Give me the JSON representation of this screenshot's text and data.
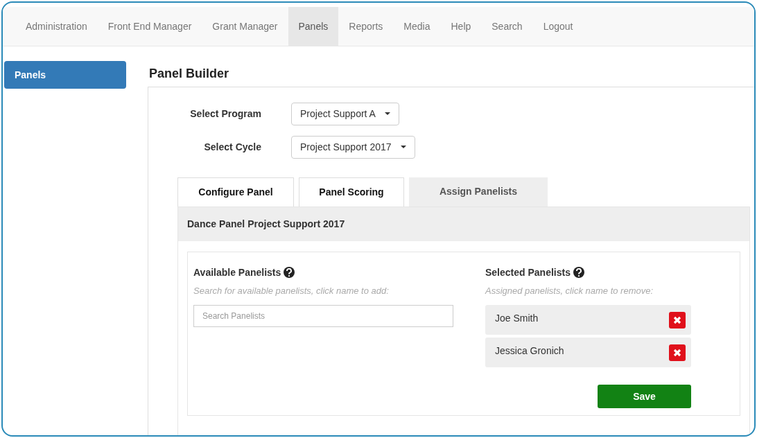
{
  "nav": [
    {
      "label": "Administration",
      "selected": false
    },
    {
      "label": "Front End Manager",
      "selected": false
    },
    {
      "label": "Grant Manager",
      "selected": false
    },
    {
      "label": "Panels",
      "selected": true
    },
    {
      "label": "Reports",
      "selected": false
    },
    {
      "label": "Media",
      "selected": false
    },
    {
      "label": "Help",
      "selected": false
    },
    {
      "label": "Search",
      "selected": false
    },
    {
      "label": "Logout",
      "selected": false
    }
  ],
  "sidebar": {
    "items": [
      {
        "label": "Panels",
        "selected": true
      }
    ]
  },
  "page_title": "Panel Builder",
  "selects": [
    {
      "label": "Select Program",
      "value": "Project Support A"
    },
    {
      "label": "Select Cycle",
      "value": "Project Support 2017"
    }
  ],
  "tabs": [
    {
      "label": "Configure Panel",
      "selected": false
    },
    {
      "label": "Panel Scoring",
      "selected": false
    },
    {
      "label": "Assign Panelists",
      "selected": true
    }
  ],
  "panel_heading": "Dance Panel Project Support 2017",
  "available": {
    "title": "Available Panelists",
    "hint": "Search for available panelists, click name to add:",
    "search": {
      "placeholder": "Search Panelists"
    }
  },
  "selected_panelists": {
    "title": "Selected Panelists",
    "hint": "Assigned panelists, click name to remove:",
    "items": [
      "Joe Smith",
      "Jessica Gronich"
    ]
  },
  "save_button": "Save"
}
